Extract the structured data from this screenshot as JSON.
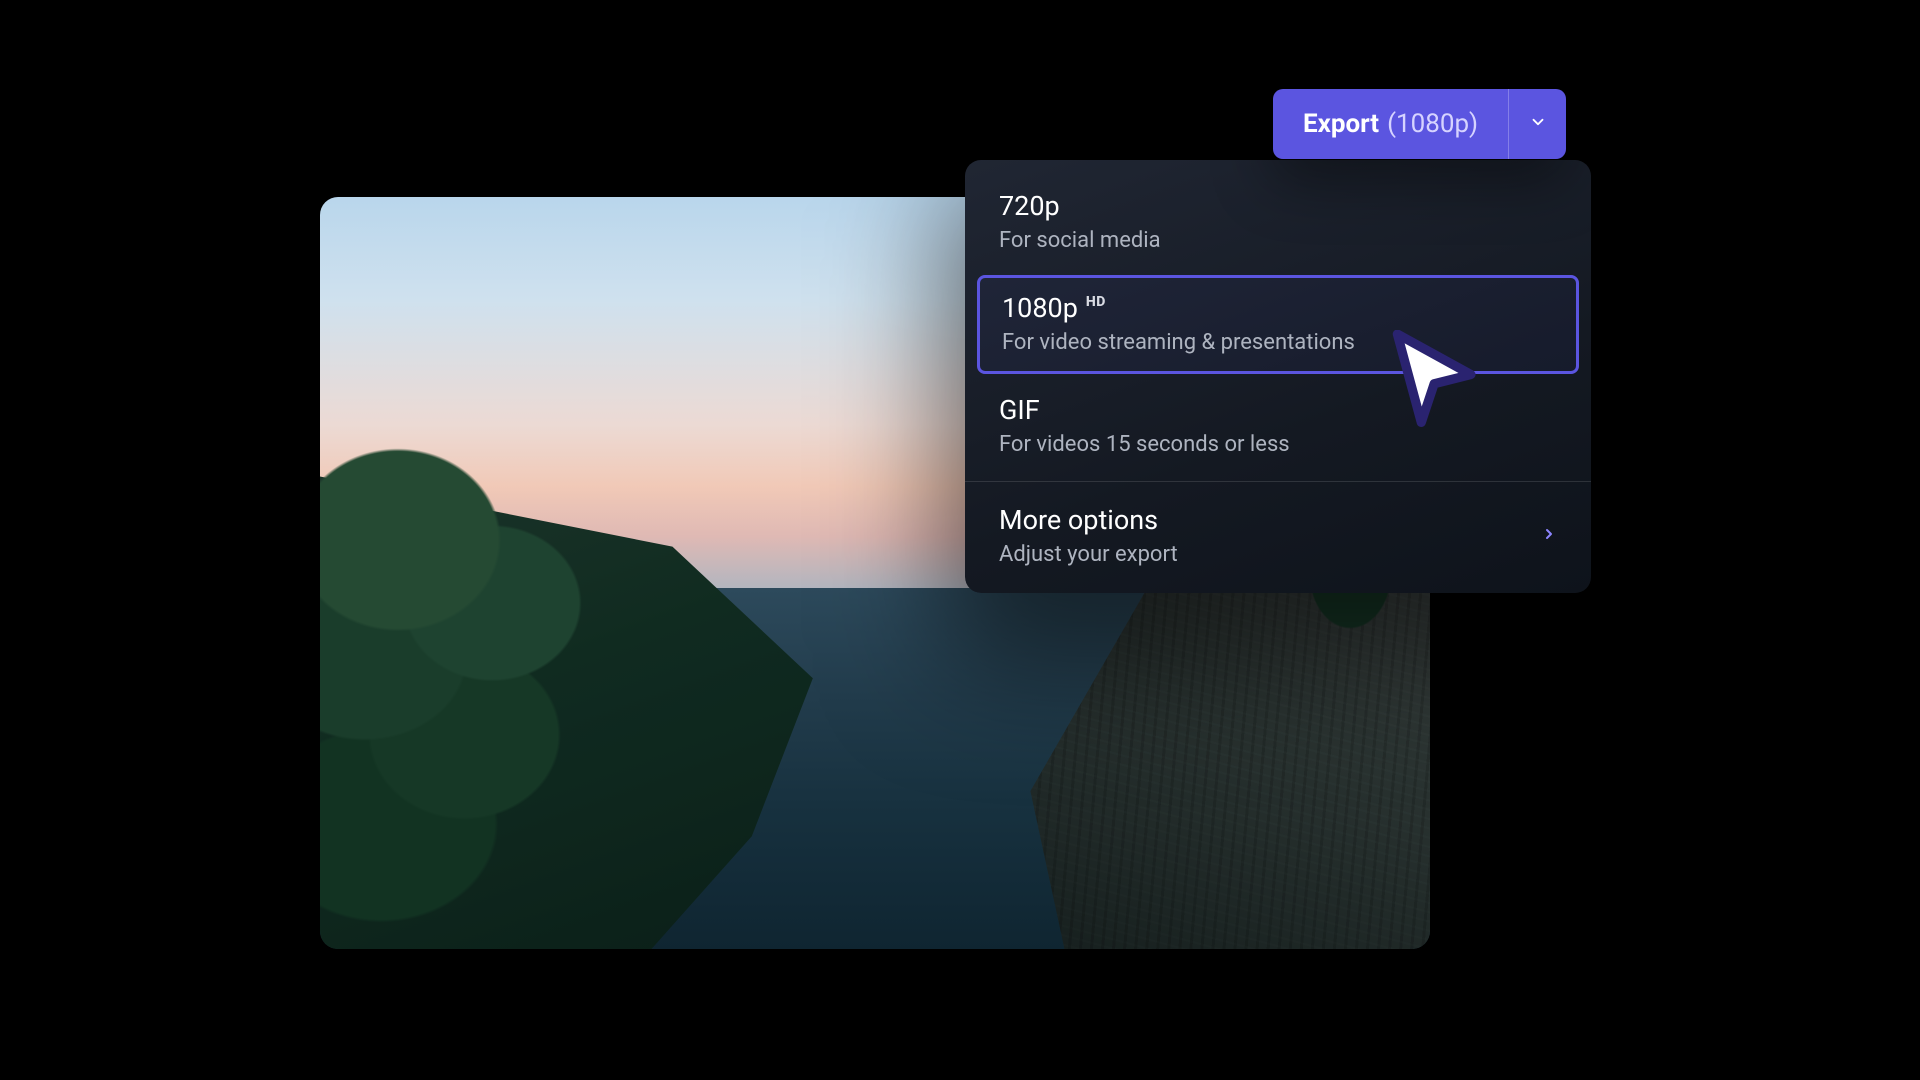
{
  "export_button": {
    "label": "Export",
    "resolution": "(1080p)"
  },
  "dropdown": {
    "options": [
      {
        "title": "720p",
        "subtitle": "For social media",
        "badge": "",
        "selected": false
      },
      {
        "title": "1080p",
        "subtitle": "For video streaming & presentations",
        "badge": "HD",
        "selected": true
      },
      {
        "title": "GIF",
        "subtitle": "For videos 15 seconds or less",
        "badge": "",
        "selected": false
      }
    ],
    "more": {
      "title": "More options",
      "subtitle": "Adjust your export"
    }
  },
  "colors": {
    "accent": "#5b55e0",
    "panel_bg": "#18202c"
  }
}
